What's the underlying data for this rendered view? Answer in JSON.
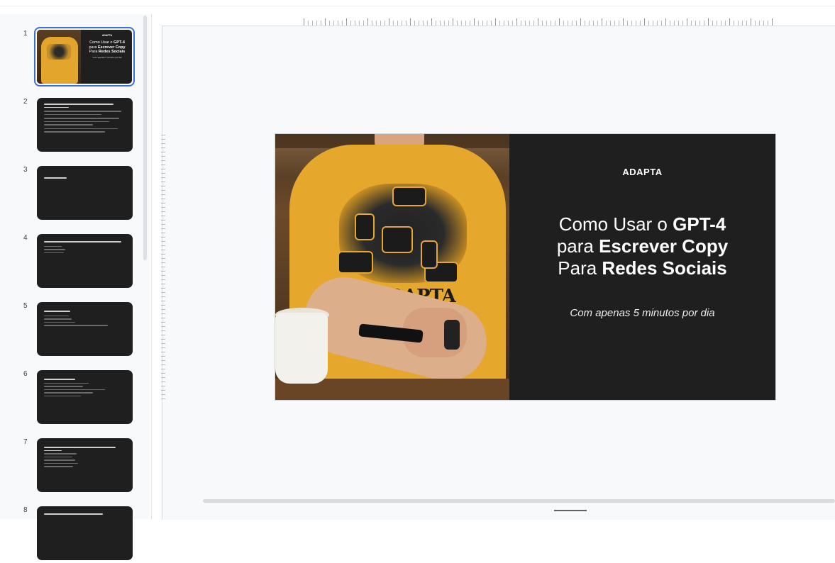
{
  "slides": [
    {
      "number": "1",
      "brand": "ADAPTA",
      "title_pre": "Como Usar o ",
      "title_b1": "GPT-4",
      "title_mid1": "para ",
      "title_b2": "Escrever Copy",
      "title_mid2": "Para ",
      "title_b3": "Redes Sociais",
      "subtitle": "Com apenas 5 minutos por dia"
    },
    {
      "number": "2"
    },
    {
      "number": "3"
    },
    {
      "number": "4"
    },
    {
      "number": "5"
    },
    {
      "number": "6"
    },
    {
      "number": "7"
    },
    {
      "number": "8"
    }
  ],
  "main_slide": {
    "brand": "ADAPTA",
    "title_pre": "Como Usar o ",
    "title_b1": "GPT-4",
    "title_mid1": "para ",
    "title_b2": "Escrever Copy",
    "title_mid2": "Para ",
    "title_b3": "Redes Sociais",
    "subtitle": "Com apenas 5 minutos por dia",
    "shirt_text": "AIDAPTA"
  },
  "colors": {
    "accent": "#3b6fd8",
    "slide_bg": "#1f1f1f",
    "shirt": "#e5a72c"
  }
}
